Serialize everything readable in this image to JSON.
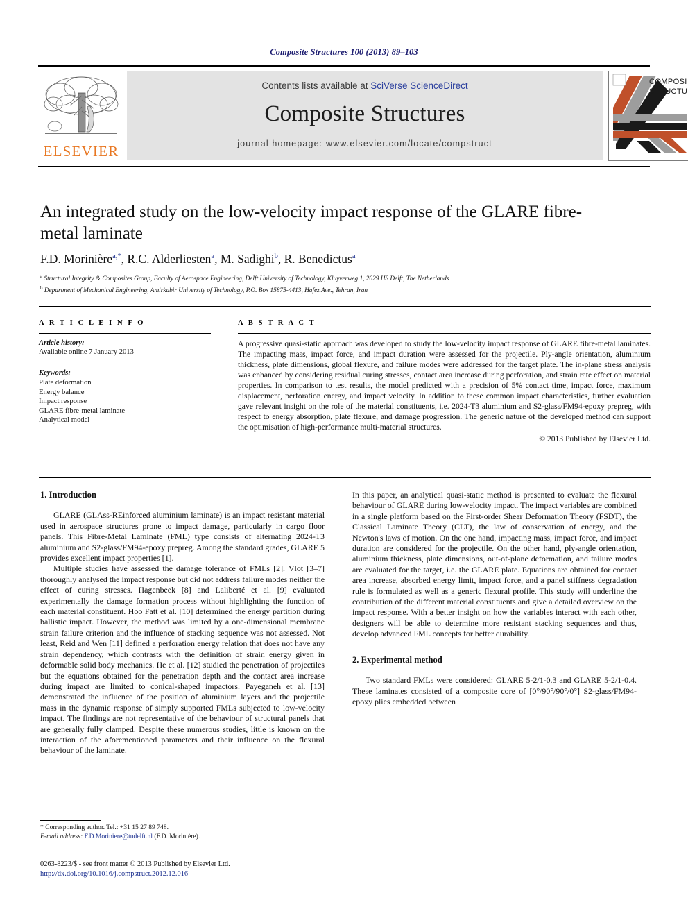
{
  "running_head": "Composite Structures 100 (2013) 89–103",
  "masthead": {
    "contents_prefix": "Contents lists available at ",
    "contents_link": "SciVerse ScienceDirect",
    "journal_name": "Composite Structures",
    "homepage": "journal homepage: www.elsevier.com/locate/compstruct",
    "publisher_wordmark": "ELSEVIER",
    "cover_title_line1": "COMPOSITE",
    "cover_title_line2": "STRUCTURES",
    "accent_orange": "#E87722",
    "link_blue": "#2b3f9e",
    "band_grey": "#e3e3e3"
  },
  "article": {
    "title": "An integrated study on the low-velocity impact response of the GLARE fibre-metal laminate",
    "authors_html": "F.D. Morinière <sup>a,*</sup>, R.C. Alderliesten <sup>a</sup>, M. Sadighi <sup>b</sup>, R. Benedictus <sup>a</sup>",
    "affiliations": [
      "Structural Integrity & Composites Group, Faculty of Aerospace Engineering, Delft University of Technology, Kluyverweg 1, 2629 HS Delft, The Netherlands",
      "Department of Mechanical Engineering, Amirkabir University of Technology, P.O. Box 15875-4413, Hafez Ave., Tehran, Iran"
    ],
    "affiliation_marks": [
      "a",
      "b"
    ]
  },
  "info": {
    "heading": "A R T I C L E   I N F O",
    "history_label": "Article history:",
    "history_value": "Available online 7 January 2013",
    "keywords_label": "Keywords:",
    "keywords": [
      "Plate deformation",
      "Energy balance",
      "Impact response",
      "GLARE fibre-metal laminate",
      "Analytical model"
    ]
  },
  "abstract": {
    "heading": "A B S T R A C T",
    "text": "A progressive quasi-static approach was developed to study the low-velocity impact response of GLARE fibre-metal laminates. The impacting mass, impact force, and impact duration were assessed for the projectile. Ply-angle orientation, aluminium thickness, plate dimensions, global flexure, and failure modes were addressed for the target plate. The in-plane stress analysis was enhanced by considering residual curing stresses, contact area increase during perforation, and strain rate effect on material properties. In comparison to test results, the model predicted with a precision of 5% contact time, impact force, maximum displacement, perforation energy, and impact velocity. In addition to these common impact characteristics, further evaluation gave relevant insight on the role of the material constituents, i.e. 2024-T3 aluminium and S2-glass/FM94-epoxy prepreg, with respect to energy absorption, plate flexure, and damage progression. The generic nature of the developed method can support the optimisation of high-performance multi-material structures.",
    "copyright": "© 2013 Published by Elsevier Ltd."
  },
  "body": {
    "section1_heading": "1. Introduction",
    "section1_p1": "GLARE (GLAss-REinforced aluminium laminate) is an impact resistant material used in aerospace structures prone to impact damage, particularly in cargo floor panels. This Fibre-Metal Laminate (FML) type consists of alternating 2024-T3 aluminium and S2-glass/FM94-epoxy prepreg. Among the standard grades, GLARE 5 provides excellent impact properties [1].",
    "section1_p2": "Multiple studies have assessed the damage tolerance of FMLs [2]. Vlot [3–7] thoroughly analysed the impact response but did not address failure modes neither the effect of curing stresses. Hagenbeek [8] and Laliberté et al. [9] evaluated experimentally the damage formation process without highlighting the function of each material constituent. Hoo Fatt et al. [10] determined the energy partition during ballistic impact. However, the method was limited by a one-dimensional membrane strain failure criterion and the influence of stacking sequence was not assessed. Not least, Reid and Wen [11] defined a perforation energy relation that does not have any strain dependency, which contrasts with the definition of strain energy given in deformable solid body mechanics. He et al. [12] studied the penetration of projectiles but the equations obtained for the penetration depth and the contact area increase during impact are limited to conical-shaped impactors. Payeganeh et al. [13] demonstrated the influence of the position of aluminium layers and the projectile mass in the dynamic response of simply supported FMLs subjected to low-velocity impact. The findings are not representative of the behaviour of structural panels that are generally fully clamped. Despite these numerous studies, little is known on the interaction of the aforementioned parameters and their influence on the flexural behaviour of the laminate.",
    "section1_p3": "In this paper, an analytical quasi-static method is presented to evaluate the flexural behaviour of GLARE during low-velocity impact. The impact variables are combined in a single platform based on the First-order Shear Deformation Theory (FSDT), the Classical Laminate Theory (CLT), the law of conservation of energy, and the Newton's laws of motion. On the one hand, impacting mass, impact force, and impact duration are considered for the projectile. On the other hand, ply-angle orientation, aluminium thickness, plate dimensions, out-of-plane deformation, and failure modes are evaluated for the target, i.e. the GLARE plate. Equations are obtained for contact area increase, absorbed energy limit, impact force, and a panel stiffness degradation rule is formulated as well as a generic flexural profile. This study will underline the contribution of the different material constituents and give a detailed overview on the impact response. With a better insight on how the variables interact with each other, designers will be able to determine more resistant stacking sequences and thus, develop advanced FML concepts for better durability.",
    "section2_heading": "2. Experimental method",
    "section2_p1": "Two standard FMLs were considered: GLARE 5-2/1-0.3 and GLARE 5-2/1-0.4. These laminates consisted of a composite core of [0°/90°/90°/0°] S2-glass/FM94-epoxy plies embedded between"
  },
  "footnote": {
    "star": "*",
    "corresponding": "Corresponding author. Tel.: +31 15 27 89 748.",
    "email_label": "E-mail address:",
    "email": "F.D.Moriniere@tudelft.nl",
    "email_suffix": "(F.D. Morinière)."
  },
  "imprint": {
    "line1": "0263-8223/$ - see front matter © 2013 Published by Elsevier Ltd.",
    "doi": "http://dx.doi.org/10.1016/j.compstruct.2012.12.016"
  }
}
